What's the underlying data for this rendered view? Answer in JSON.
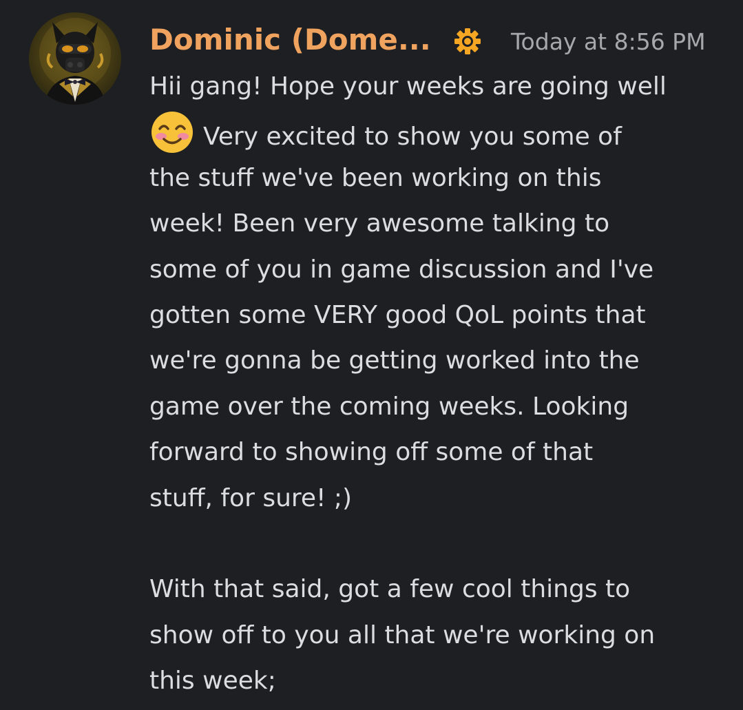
{
  "message": {
    "author": "Dominic (Dome...",
    "author_color": "#f0a35e",
    "role_icon": "gear-icon",
    "timestamp": "Today at 8:56 PM",
    "emoji": "smiling-face-with-smiling-eyes",
    "lines": [
      "Hii gang! Hope your weeks are going well",
      "Very excited to show you some of",
      "the stuff we've been working on this",
      "week! Been very awesome talking to",
      "some of you in game discussion and I've",
      "gotten some VERY good QoL points that",
      "we're gonna be getting worked into the",
      "game over the coming weeks. Looking",
      "forward to showing off some of that",
      "stuff, for sure! ;)",
      "",
      "With that said, got a few cool things to",
      "show off to you all that we're working on",
      "this week;"
    ]
  }
}
